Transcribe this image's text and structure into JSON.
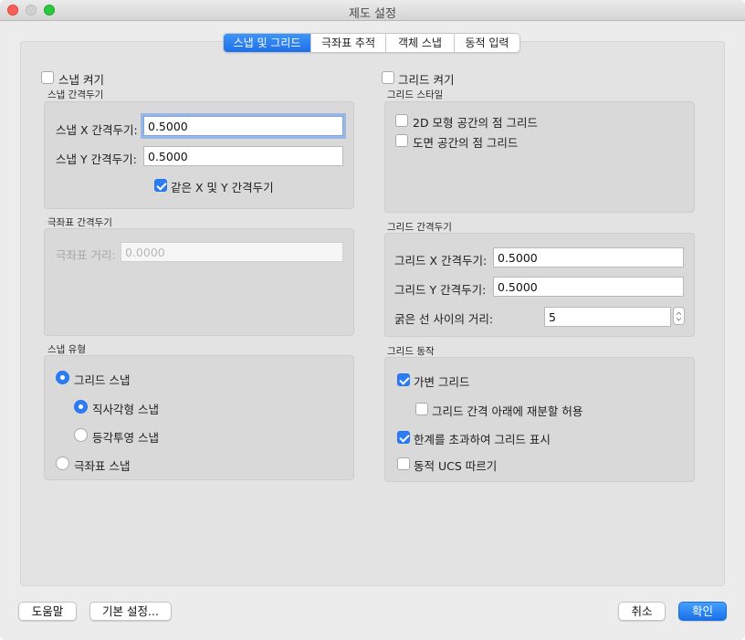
{
  "window": {
    "title": "제도 설정"
  },
  "tabs": [
    {
      "label": "스냅 및 그리드",
      "active": true
    },
    {
      "label": "극좌표 추적",
      "active": false
    },
    {
      "label": "객체 스냅",
      "active": false
    },
    {
      "label": "동적 입력",
      "active": false
    }
  ],
  "snap": {
    "enable_label": "스냅 켜기",
    "enabled": false,
    "spacing_title": "스냅 간격두기",
    "x_label": "스냅 X 간격두기:",
    "x_value": "0.5000",
    "y_label": "스냅 Y 간격두기:",
    "y_value": "0.5000",
    "equal_label": "같은 X 및 Y 간격두기",
    "equal_checked": true
  },
  "polar": {
    "title": "극좌표 간격두기",
    "distance_label": "극좌표 거리:",
    "distance_value": "0.0000"
  },
  "snap_type": {
    "title": "스냅 유형",
    "grid_snap": "그리드 스냅",
    "rectangular": "직사각형 스냅",
    "isometric": "등각투영 스냅",
    "polar_snap": "극좌표 스냅",
    "selected": "grid_snap",
    "sub_selected": "rectangular"
  },
  "grid": {
    "enable_label": "그리드 켜기",
    "enabled": false,
    "style_title": "그리드 스타일",
    "dot_2d": "2D 모형 공간의 점 그리드",
    "dot_layout": "도면 공간의 점 그리드",
    "spacing_title": "그리드 간격두기",
    "x_label": "그리드 X 간격두기:",
    "x_value": "0.5000",
    "y_label": "그리드 Y 간격두기:",
    "y_value": "0.5000",
    "major_label": "굵은 선 사이의 거리:",
    "major_value": "5",
    "behavior_title": "그리드 동작",
    "adaptive": "가변 그리드",
    "adaptive_checked": true,
    "subdivide": "그리드 간격 아래에 재분할 허용",
    "subdivide_checked": false,
    "beyond_limits": "한계를 초과하여 그리드 표시",
    "beyond_limits_checked": true,
    "follow_ucs": "동적 UCS 따르기",
    "follow_ucs_checked": false
  },
  "footer": {
    "help": "도움말",
    "defaults": "기본 설정...",
    "cancel": "취소",
    "ok": "확인"
  },
  "colors": {
    "accent": "#2c7cf6"
  }
}
